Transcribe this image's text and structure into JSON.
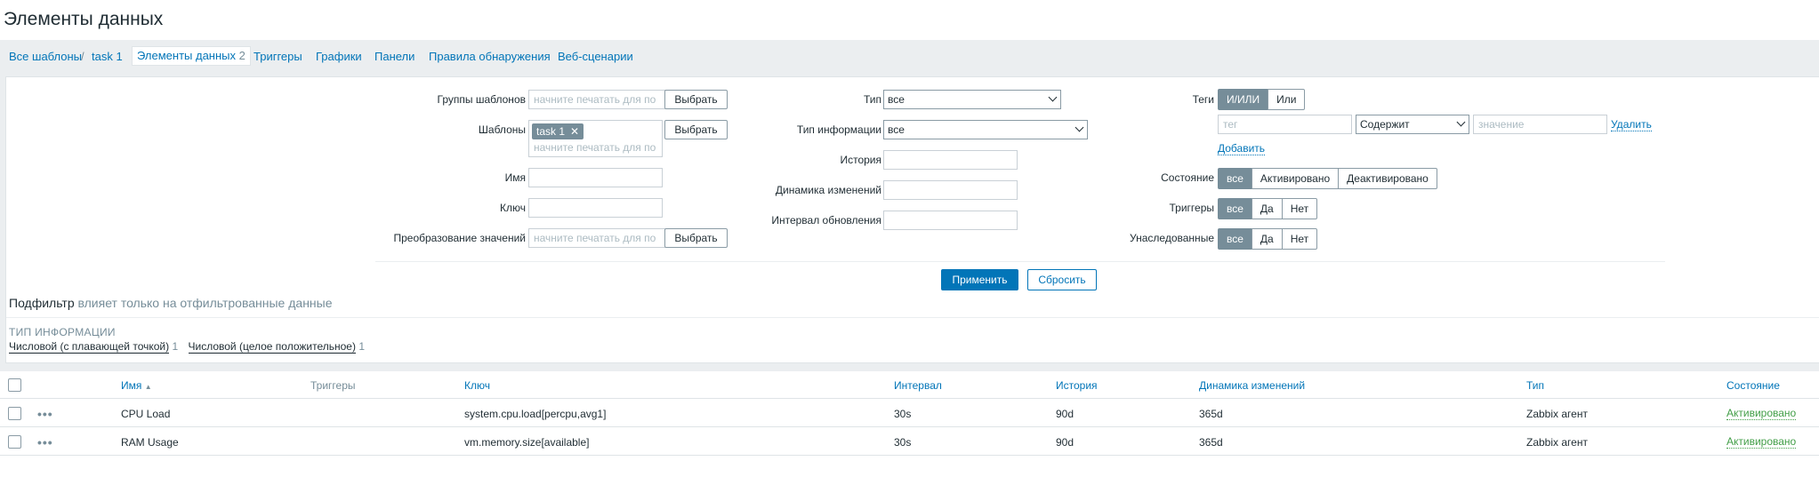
{
  "page": {
    "title": "Элементы данных"
  },
  "nav": {
    "all_templates": "Все шаблоны",
    "separator": "/",
    "template": "task 1",
    "items_label": "Элементы данных",
    "items_count": "2",
    "triggers": "Триггеры",
    "graphs": "Графики",
    "dashboards": "Панели",
    "discovery": "Правила обнаружения",
    "web": "Веб-сценарии"
  },
  "filter": {
    "template_groups": {
      "label": "Группы шаблонов",
      "placeholder": "начните печатать для по",
      "button": "Выбрать"
    },
    "templates": {
      "label": "Шаблоны",
      "chip": "task 1",
      "chip_remove": "✕",
      "placeholder": "начните печатать для по",
      "button": "Выбрать"
    },
    "name": {
      "label": "Имя",
      "value": ""
    },
    "key": {
      "label": "Ключ",
      "value": ""
    },
    "preprocessing": {
      "label": "Преобразование значений",
      "placeholder": "начните печатать для по",
      "button": "Выбрать"
    },
    "type": {
      "label": "Тип",
      "value": "все"
    },
    "info_type": {
      "label": "Тип информации",
      "value": "все"
    },
    "history": {
      "label": "История",
      "value": ""
    },
    "trends": {
      "label": "Динамика изменений",
      "value": ""
    },
    "interval": {
      "label": "Интервал обновления",
      "value": ""
    },
    "tags": {
      "label": "Теги",
      "and_or": "И/ИЛИ",
      "or": "Или",
      "tag_placeholder": "тег",
      "operator": "Содержит",
      "value_placeholder": "значение",
      "remove": "Удалить",
      "add": "Добавить"
    },
    "state": {
      "label": "Состояние",
      "options": [
        "все",
        "Активировано",
        "Деактивировано"
      ]
    },
    "triggers": {
      "label": "Триггеры",
      "options": [
        "все",
        "Да",
        "Нет"
      ]
    },
    "inherited": {
      "label": "Унаследованные",
      "options": [
        "все",
        "Да",
        "Нет"
      ]
    },
    "apply": "Применить",
    "reset": "Сбросить"
  },
  "subfilter": {
    "title": "Подфильтр",
    "note": "влияет только на отфильтрованные данные",
    "section_title": "ТИП ИНФОРМАЦИИ",
    "options": [
      {
        "label": "Числовой (с плавающей точкой)",
        "count": "1"
      },
      {
        "label": "Числовой (целое положительное)",
        "count": "1"
      }
    ]
  },
  "table": {
    "headers": {
      "name": "Имя",
      "sort_indicator": "▲",
      "triggers": "Триггеры",
      "key": "Ключ",
      "interval": "Интервал",
      "history": "История",
      "trends": "Динамика изменений",
      "type": "Тип",
      "status": "Состояние"
    },
    "rows": [
      {
        "menu": "•••",
        "name": "CPU Load",
        "key": "system.cpu.load[percpu,avg1]",
        "interval": "30s",
        "history": "90d",
        "trends": "365d",
        "type": "Zabbix агент",
        "status": "Активировано"
      },
      {
        "menu": "•••",
        "name": "RAM Usage",
        "key": "vm.memory.size[available]",
        "interval": "30s",
        "history": "90d",
        "trends": "365d",
        "type": "Zabbix агент",
        "status": "Активировано"
      }
    ]
  },
  "colors": {
    "accent": "#0275b8",
    "status_enabled": "#429e47",
    "toggle_on": "#768d99"
  }
}
